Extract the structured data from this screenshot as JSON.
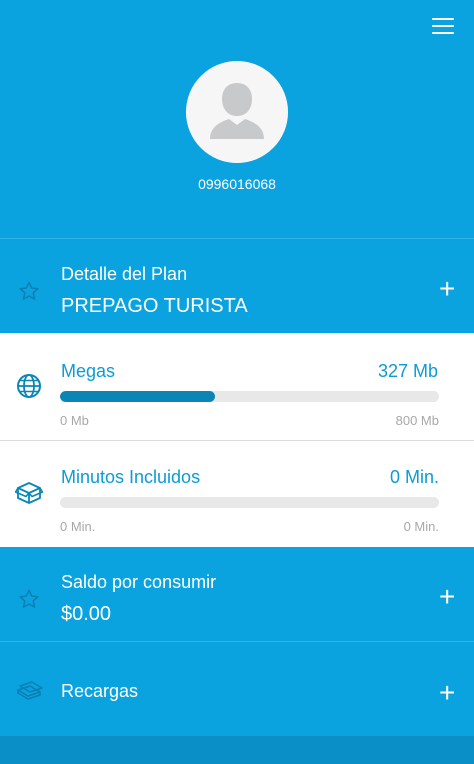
{
  "profile": {
    "phone": "0996016068"
  },
  "plan": {
    "title": "Detalle del Plan",
    "name": "PREPAGO TURISTA",
    "icon": "star-icon",
    "expand": "+"
  },
  "megas": {
    "label": "Megas",
    "value": "327 Mb",
    "min_label": "0 Mb",
    "max_label": "800 Mb",
    "progress": 0.41,
    "icon": "globe-icon"
  },
  "minutes": {
    "label": "Minutos Incluidos",
    "value": "0 Min.",
    "min_label": "0 Min.",
    "max_label": "0 Min.",
    "progress": 0,
    "icon": "box-icon"
  },
  "balance": {
    "label": "Saldo por consumir",
    "value": "$0.00",
    "icon": "star-icon",
    "expand": "+"
  },
  "recharges": {
    "label": "Recargas",
    "icon": "money-icon",
    "expand": "+"
  },
  "colors": {
    "primary": "#0ba2e0",
    "accent_text": "#0b9bd6",
    "bar_fill": "#0a86b6",
    "bar_track": "#e8e8e8",
    "footer": "#0a8fc6"
  }
}
